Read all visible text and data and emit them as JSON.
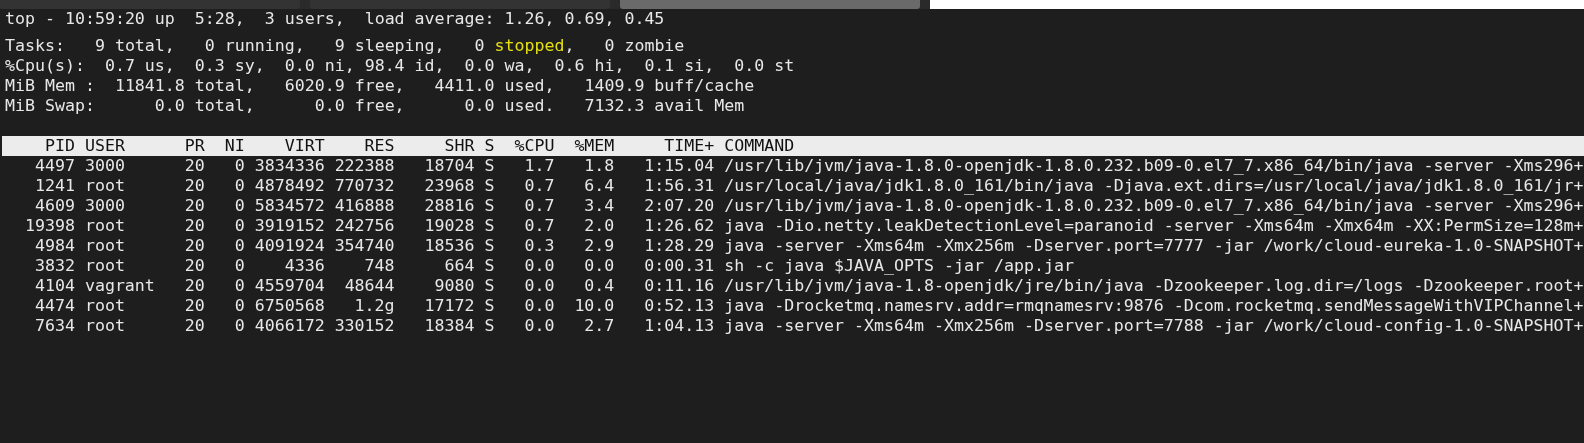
{
  "window_tabs": [
    {
      "selected": false
    },
    {
      "selected": false
    },
    {
      "selected": true
    }
  ],
  "summary": [
    {
      "segments": [
        {
          "text": "top - 10:59:20 up  5:28,  3 users,  load average: 1.26, 0.69, 0.45",
          "highlight": false
        }
      ]
    },
    {
      "segments": [
        {
          "text": "Tasks:   9 total,   0 running,   9 sleeping,   0 ",
          "highlight": false
        },
        {
          "text": "stopped",
          "highlight": true
        },
        {
          "text": ",   0 zombie",
          "highlight": false
        }
      ]
    },
    {
      "segments": [
        {
          "text": "%Cpu(s):  0.7 us,  0.3 sy,  0.0 ni, 98.4 id,  0.0 wa,  0.6 hi,  0.1 si,  0.0 st",
          "highlight": false
        }
      ]
    },
    {
      "segments": [
        {
          "text": "MiB Mem :  11841.8 total,   6020.9 free,   4411.0 used,   1409.9 buff/cache",
          "highlight": false
        }
      ]
    },
    {
      "segments": [
        {
          "text": "MiB Swap:      0.0 total,      0.0 free,      0.0 used.   7132.3 avail Mem",
          "highlight": false
        }
      ]
    }
  ],
  "table": {
    "columns": [
      "PID",
      "USER",
      "PR",
      "NI",
      "VIRT",
      "RES",
      "SHR",
      "S",
      "%CPU",
      "%MEM",
      "TIME+",
      "COMMAND"
    ],
    "rows": [
      {
        "cells": [
          "4497",
          "3000",
          "20",
          "0",
          "3834336",
          "222388",
          "18704",
          "S",
          "1.7",
          "1.8",
          "1:15.04",
          "/usr/lib/jvm/java-1.8.0-openjdk-1.8.0.232.b09-0.el7_7.x86_64/bin/java -server -Xms296+"
        ]
      },
      {
        "cells": [
          "1241",
          "root",
          "20",
          "0",
          "4878492",
          "770732",
          "23968",
          "S",
          "0.7",
          "6.4",
          "1:56.31",
          "/usr/local/java/jdk1.8.0_161/bin/java -Djava.ext.dirs=/usr/local/java/jdk1.8.0_161/jr+"
        ]
      },
      {
        "cells": [
          "4609",
          "3000",
          "20",
          "0",
          "5834572",
          "416888",
          "28816",
          "S",
          "0.7",
          "3.4",
          "2:07.20",
          "/usr/lib/jvm/java-1.8.0-openjdk-1.8.0.232.b09-0.el7_7.x86_64/bin/java -server -Xms296+"
        ]
      },
      {
        "cells": [
          "19398",
          "root",
          "20",
          "0",
          "3919152",
          "242756",
          "19028",
          "S",
          "0.7",
          "2.0",
          "1:26.62",
          "java -Dio.netty.leakDetectionLevel=paranoid -server -Xms64m -Xmx64m -XX:PermSize=128m+"
        ]
      },
      {
        "cells": [
          "4984",
          "root",
          "20",
          "0",
          "4091924",
          "354740",
          "18536",
          "S",
          "0.3",
          "2.9",
          "1:28.29",
          "java -server -Xms64m -Xmx256m -Dserver.port=7777 -jar /work/cloud-eureka-1.0-SNAPSHOT+"
        ]
      },
      {
        "cells": [
          "3832",
          "root",
          "20",
          "0",
          "4336",
          "748",
          "664",
          "S",
          "0.0",
          "0.0",
          "0:00.31",
          "sh -c java $JAVA_OPTS -jar /app.jar"
        ]
      },
      {
        "cells": [
          "4104",
          "vagrant",
          "20",
          "0",
          "4559704",
          "48644",
          "9080",
          "S",
          "0.0",
          "0.4",
          "0:11.16",
          "/usr/lib/jvm/java-1.8-openjdk/jre/bin/java -Dzookeeper.log.dir=/logs -Dzookeeper.root+"
        ]
      },
      {
        "cells": [
          "4474",
          "root",
          "20",
          "0",
          "6750568",
          "1.2g",
          "17172",
          "S",
          "0.0",
          "10.0",
          "0:52.13",
          "java -Drocketmq.namesrv.addr=rmqnamesrv:9876 -Dcom.rocketmq.sendMessageWithVIPChannel+"
        ]
      },
      {
        "cells": [
          "7634",
          "root",
          "20",
          "0",
          "4066172",
          "330152",
          "18384",
          "S",
          "0.0",
          "2.7",
          "1:04.13",
          "java -server -Xms64m -Xmx256m -Dserver.port=7788 -jar /work/cloud-config-1.0-SNAPSHOT+"
        ]
      }
    ]
  }
}
